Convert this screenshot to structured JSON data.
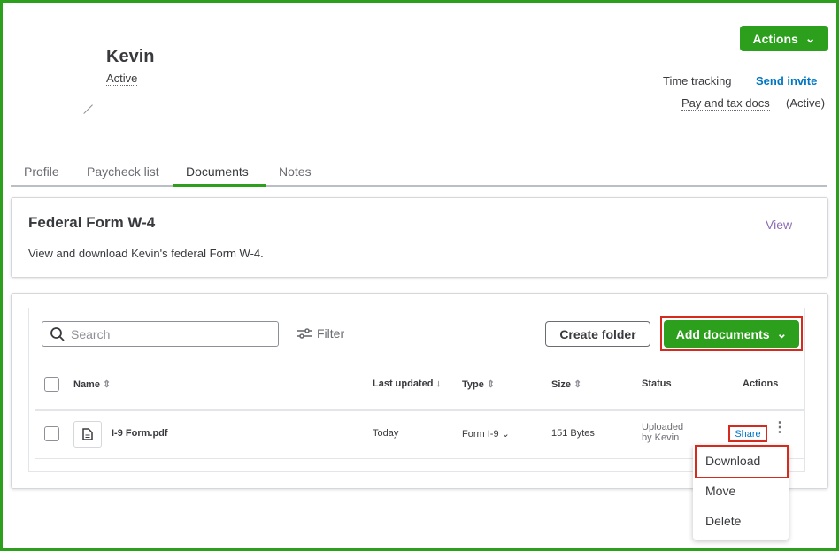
{
  "header": {
    "actions_label": "Actions",
    "employee_name": "Kevin",
    "status": "Active",
    "time_tracking": "Time tracking",
    "send_invite": "Send invite",
    "pay_tax_docs": "Pay and tax docs",
    "pay_tax_status": "(Active)"
  },
  "tabs": [
    {
      "label": "Profile"
    },
    {
      "label": "Paycheck list"
    },
    {
      "label": "Documents",
      "active": true
    },
    {
      "label": "Notes"
    }
  ],
  "w4_card": {
    "title": "Federal Form W-4",
    "description": "View and download Kevin's federal Form W-4.",
    "view_link": "View"
  },
  "toolbar": {
    "search_placeholder": "Search",
    "filter_label": "Filter",
    "create_folder": "Create folder",
    "add_documents": "Add documents"
  },
  "table": {
    "columns": [
      "Name",
      "Last updated",
      "Type",
      "Size",
      "Status",
      "Actions"
    ],
    "rows": [
      {
        "name": "I-9 Form.pdf",
        "last_updated": "Today",
        "type": "Form I-9",
        "size": "151 Bytes",
        "status_line1": "Uploaded",
        "status_line2": "by Kevin",
        "action": "Share"
      }
    ]
  },
  "row_menu": {
    "items": [
      "Download",
      "Move",
      "Delete"
    ]
  },
  "colors": {
    "green": "#2ca01c",
    "link_blue": "#0077c5",
    "view_purple": "#8d6cb5",
    "highlight_red": "#d52b1e"
  }
}
